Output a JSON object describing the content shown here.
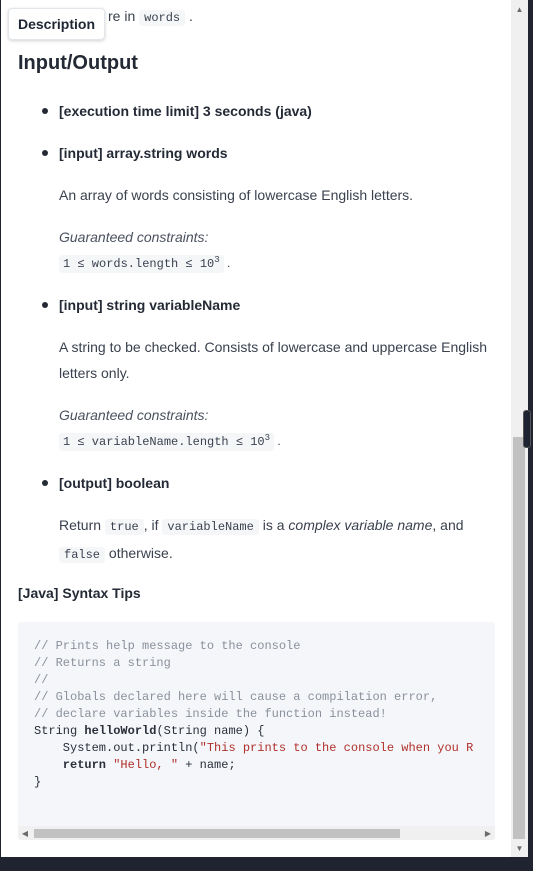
{
  "tab": {
    "label": "Description"
  },
  "top_line": {
    "prefix": "re in",
    "code": "words",
    "suffix": "."
  },
  "section_title": "Input/Output",
  "items": [
    {
      "title": "[execution time limit] 3 seconds (java)"
    },
    {
      "title": "[input] array.string words",
      "description": "An array of words consisting of lowercase English letters.",
      "constraints_label": "Guaranteed constraints:",
      "constraint": "1 ≤ words.length ≤ 10",
      "constraint_exp": "3"
    },
    {
      "title": "[input] string variableName",
      "description": "A string to be checked. Consists of lowercase and uppercase English letters only.",
      "constraints_label": "Guaranteed constraints:",
      "constraint": "1 ≤ variableName.length ≤ 10",
      "constraint_exp": "3"
    },
    {
      "title": "[output] boolean",
      "return_word": "Return",
      "code_true": "true",
      "if_word": ", if",
      "code_var": "variableName",
      "is_a": "is a",
      "emph": "complex variable name",
      "and_word": ", and",
      "code_false": "false",
      "otherwise": "otherwise."
    }
  ],
  "syntax_title": "[Java] Syntax Tips",
  "code": {
    "c1": "// Prints help message to the console",
    "c2": "// Returns a string",
    "c3": "//",
    "c4": "// Globals declared here will cause a compilation error,",
    "c5": "// declare variables inside the function instead!",
    "l6_type": "String ",
    "l6_fn": "helloWorld",
    "l6_rest": "(String name) {",
    "l7_pre": "    System.out.println(",
    "l7_str": "\"This prints to the console when you R",
    "l8_kw": "    return ",
    "l8_str": "\"Hello, \"",
    "l8_rest": " + name;",
    "l9": "}"
  },
  "icons": {
    "scroll_up": "arrow-up-icon",
    "scroll_down": "arrow-down-icon",
    "scroll_left": "arrow-left-icon",
    "scroll_right": "arrow-right-icon"
  }
}
